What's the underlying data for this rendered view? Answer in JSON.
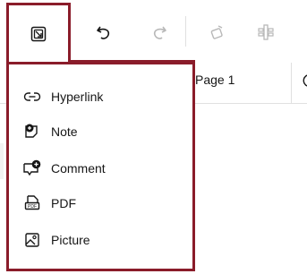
{
  "toolbar": {
    "buttons": [
      {
        "name": "insert-button",
        "icon": "insert-object-icon"
      },
      {
        "name": "undo-button",
        "icon": "undo-icon"
      },
      {
        "name": "redo-button",
        "icon": "redo-icon"
      },
      {
        "name": "format-painter-button",
        "icon": "paint-icon"
      },
      {
        "name": "column-button",
        "icon": "column-icon"
      }
    ]
  },
  "tabs": {
    "active_label": "Page 1"
  },
  "insert_menu": {
    "items": [
      {
        "label": "Hyperlink",
        "icon": "link-icon"
      },
      {
        "label": "Note",
        "icon": "note-icon"
      },
      {
        "label": "Comment",
        "icon": "comment-icon"
      },
      {
        "label": "PDF",
        "icon": "pdf-icon"
      },
      {
        "label": "Picture",
        "icon": "picture-icon"
      }
    ],
    "highlight_color": "#8a1c2a"
  }
}
